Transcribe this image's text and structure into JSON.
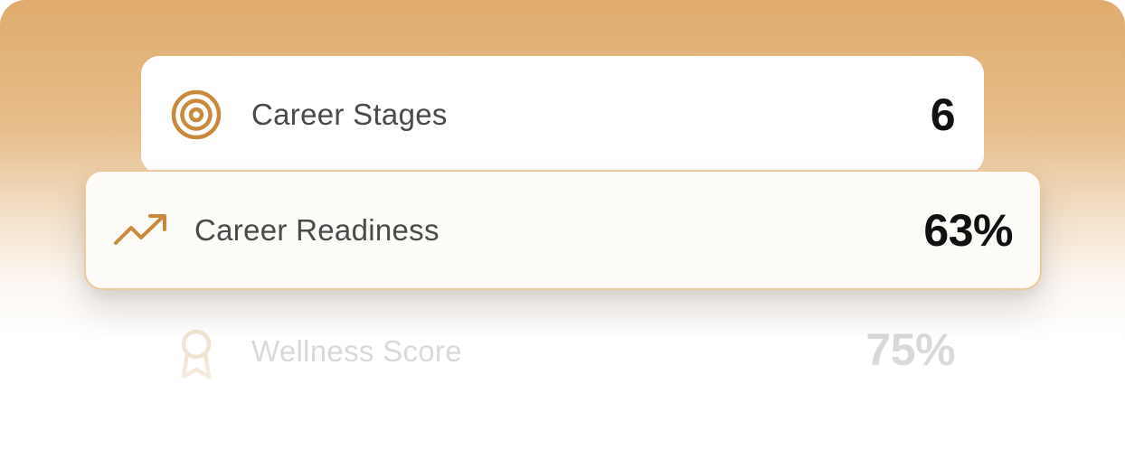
{
  "stats": [
    {
      "label": "Career Stages",
      "value": "6",
      "icon": "target-icon"
    },
    {
      "label": "Career Readiness",
      "value": "63%",
      "icon": "trending-up-icon"
    },
    {
      "label": "Wellness Score",
      "value": "75%",
      "icon": "award-ribbon-icon"
    }
  ],
  "colors": {
    "accent": "#c98a3c",
    "background_top": "#e0ac6d",
    "active_border": "#ecc99c",
    "label_text": "#4a4a4a",
    "value_text": "#111111"
  }
}
